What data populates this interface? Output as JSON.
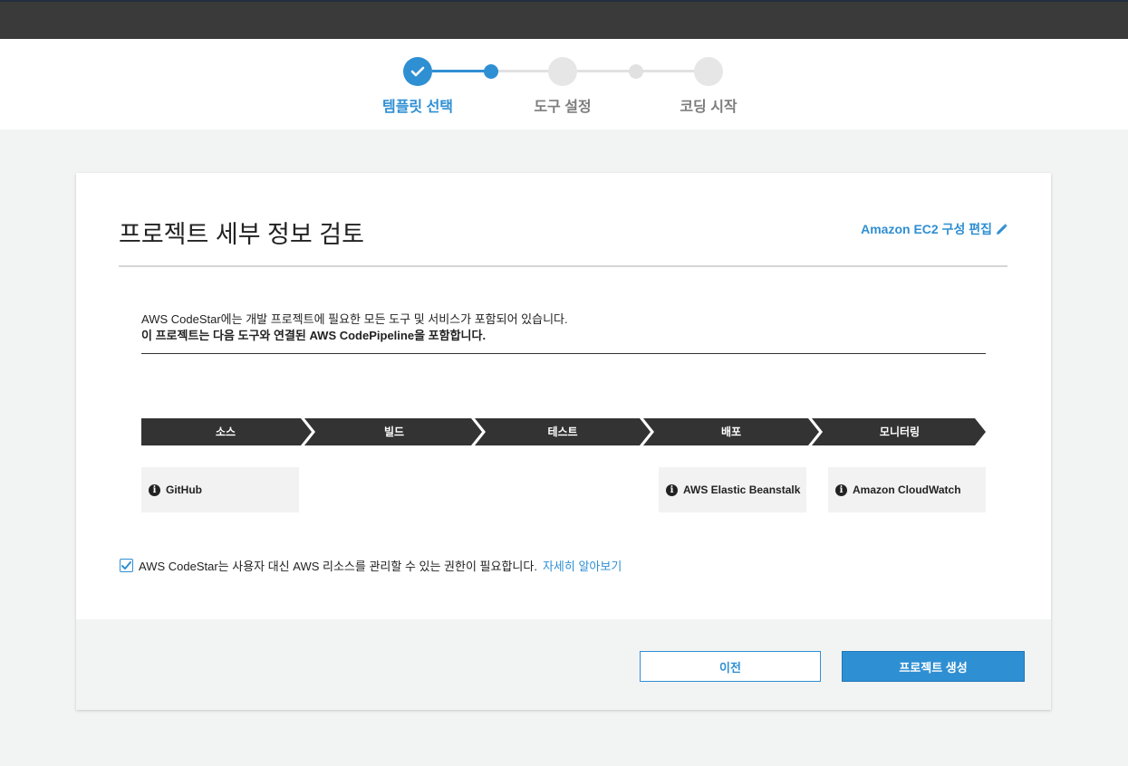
{
  "steps": [
    {
      "label": "템플릿 선택",
      "state": "done"
    },
    {
      "label": "도구 설정",
      "state": "upcoming"
    },
    {
      "label": "코딩 시작",
      "state": "upcoming"
    }
  ],
  "card": {
    "title": "프로젝트 세부 정보 검토",
    "edit_link": "Amazon EC2 구성 편집",
    "description_line1": "AWS CodeStar에는 개발 프로젝트에 필요한 모든 도구 및 서비스가 포함되어 있습니다.",
    "description_line2": "이 프로젝트는 다음 도구와 연결된 AWS CodePipeline을 포함합니다."
  },
  "pipeline": {
    "stages": [
      "소스",
      "빌드",
      "테스트",
      "배포",
      "모니터링"
    ],
    "tools": {
      "source": "GitHub",
      "deploy": "AWS Elastic Beanstalk",
      "monitor": "Amazon CloudWatch"
    }
  },
  "consent": {
    "checked": true,
    "text": "AWS CodeStar는 사용자 대신 AWS 리소스를 관리할 수 있는 권한이 필요합니다.",
    "link": "자세히 알아보기"
  },
  "footer": {
    "prev_label": "이전",
    "create_label": "프로젝트 생성"
  },
  "colors": {
    "accent": "#2f8fd3",
    "topbar": "#3a3a3a",
    "pipeline": "#333333"
  }
}
